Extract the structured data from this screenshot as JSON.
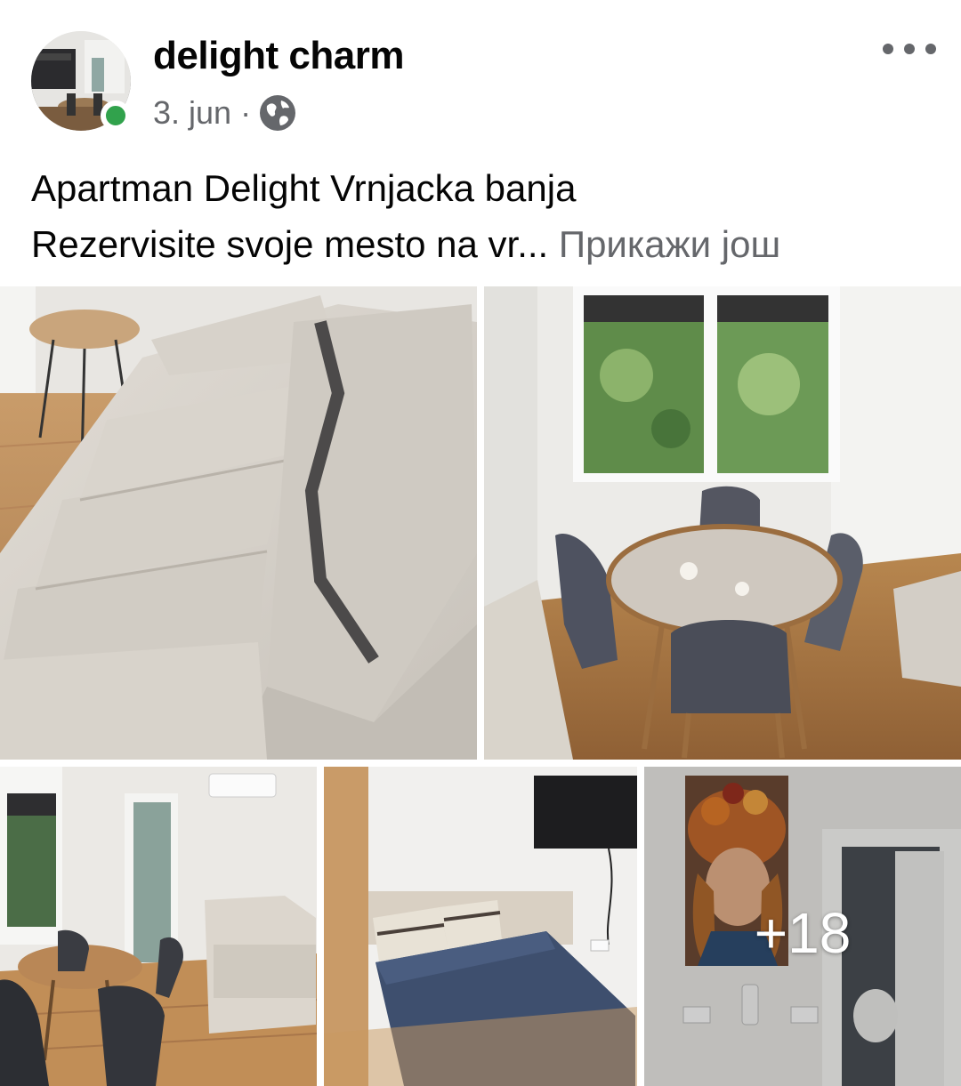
{
  "post": {
    "author": "delight charm",
    "date": "3. jun",
    "separator": "·",
    "audience_icon": "globe-icon",
    "more_icon": "more-options-icon",
    "caption_line1": "Apartman Delight Vrnjacka banja",
    "caption_line2": "Rezervisite svoje mesto na vr...",
    "see_more": "Прикажи још",
    "extra_photos": "+18"
  },
  "photos": [
    {
      "name": "photo-sofa",
      "description_icon": "photo"
    },
    {
      "name": "photo-dining-table",
      "description_icon": "photo"
    },
    {
      "name": "photo-living-room",
      "description_icon": "photo"
    },
    {
      "name": "photo-bedroom",
      "description_icon": "photo"
    },
    {
      "name": "photo-hallway",
      "description_icon": "photo"
    }
  ],
  "colors": {
    "online": "#31a24c",
    "secondary_text": "#65676b",
    "primary_text": "#050505"
  }
}
